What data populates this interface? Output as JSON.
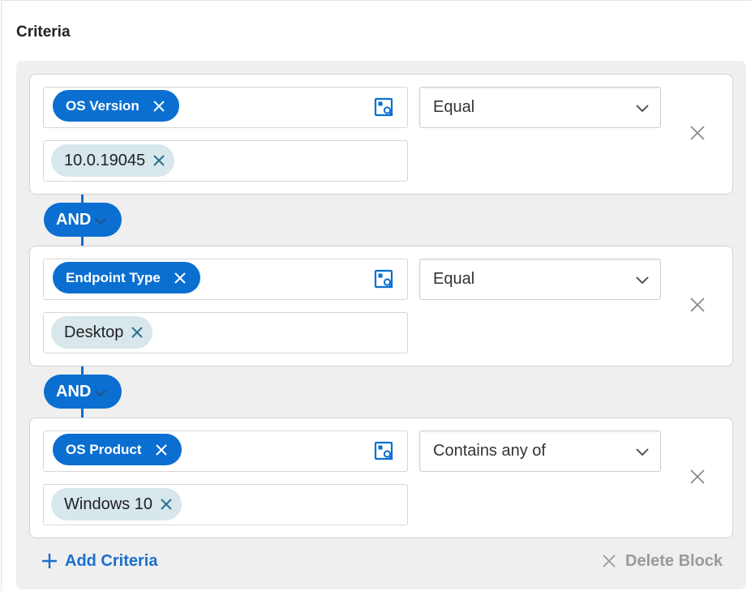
{
  "section": {
    "title": "Criteria"
  },
  "criteria": [
    {
      "field": "OS Version",
      "operator": "Equal",
      "value": "10.0.19045"
    },
    {
      "field": "Endpoint Type",
      "operator": "Equal",
      "value": "Desktop"
    },
    {
      "field": "OS Product",
      "operator": "Contains any of",
      "value": "Windows 10"
    }
  ],
  "connectors": [
    {
      "label": "AND"
    },
    {
      "label": "AND"
    }
  ],
  "actions": {
    "add_criteria": "Add Criteria",
    "delete_block": "Delete Block"
  },
  "colors": {
    "accent": "#0a6fd1",
    "value_chip": "#d7e7ec",
    "block_background": "#efefef",
    "delete_text": "#9a9a9a"
  },
  "icons": {
    "field_browse": "field-browse-icon",
    "dropdown": "chevron-down-icon",
    "remove": "close-icon",
    "add": "plus-icon"
  }
}
